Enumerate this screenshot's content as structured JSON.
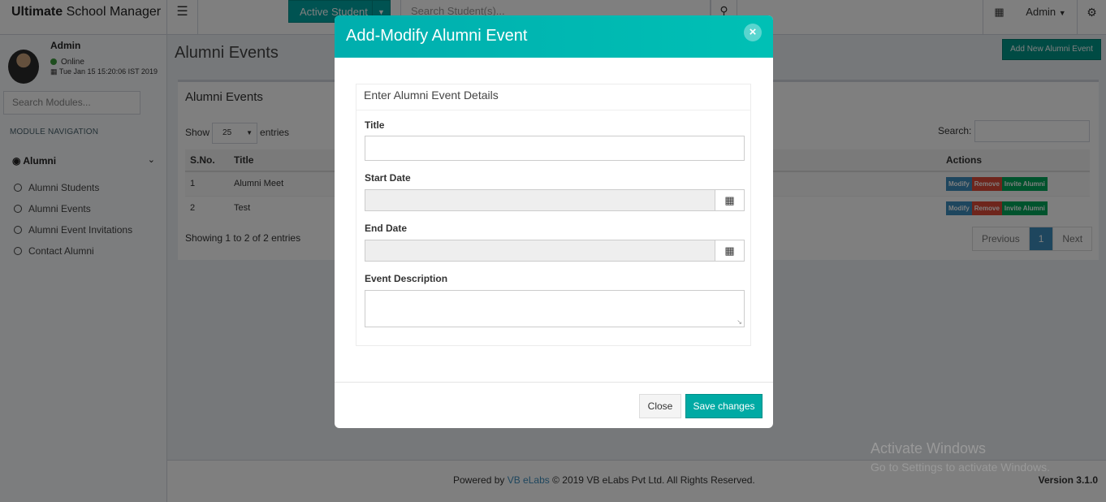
{
  "app": {
    "brand_bold": "Ultimate",
    "brand_rest": " School Manager",
    "menu_icon": "hamburger-icon",
    "active_student": "Active Student",
    "student_search_placeholder": "Search Student(s)...",
    "admin_menu": "Admin",
    "apps_icon": "grid-icon",
    "settings_icon": "gears-icon"
  },
  "sidebar": {
    "user_name": "Admin",
    "status": "Online",
    "timestamp": "Tue Jan 15 15:20:06 IST 2019",
    "module_search_placeholder": "Search Modules...",
    "nav_header": "MODULE NAVIGATION",
    "group_label": "Alumni",
    "items": [
      {
        "label": "Alumni Students"
      },
      {
        "label": "Alumni Events"
      },
      {
        "label": "Alumni Event Invitations"
      },
      {
        "label": "Contact Alumni"
      }
    ]
  },
  "page": {
    "title": "Alumni Events",
    "add_button": "Add New Alumni Event"
  },
  "table": {
    "box_title": "Alumni Events",
    "show_label": "Show",
    "page_size": "25",
    "entries_label": "entries",
    "search_label": "Search:",
    "headers": {
      "sno": "S.No.",
      "title": "Title",
      "actions": "Actions"
    },
    "rows": [
      {
        "sno": "1",
        "title": "Alumni Meet"
      },
      {
        "sno": "2",
        "title": "Test"
      }
    ],
    "action_labels": {
      "modify": "Modify",
      "remove": "Remove",
      "invite": "Invite Alumni"
    },
    "info": "Showing 1 to 2 of 2 entries",
    "pager": {
      "previous": "Previous",
      "current": "1",
      "next": "Next"
    }
  },
  "modal": {
    "title": "Add-Modify Alumni Event",
    "panel_title": "Enter Alumni Event Details",
    "fields": {
      "title_label": "Title",
      "title_value": "",
      "start_label": "Start Date",
      "start_value": "",
      "end_label": "End Date",
      "end_value": "",
      "description_label": "Event Description",
      "description_value": ""
    },
    "close_button": "Close",
    "save_button": "Save changes"
  },
  "footer": {
    "powered": "Powered by",
    "link": "VB eLabs",
    "copyright": "© 2019 VB eLabs Pvt Ltd. All Rights Reserved.",
    "version": "Version 3.1.0"
  },
  "watermark": {
    "line1": "Activate Windows",
    "line2": "Go to Settings to activate Windows."
  },
  "colors": {
    "modal_header": "#00b5b0",
    "save_button": "#00aaa4",
    "modify": "#3c8dbc",
    "remove": "#dd4b39",
    "invite": "#00a65a"
  }
}
